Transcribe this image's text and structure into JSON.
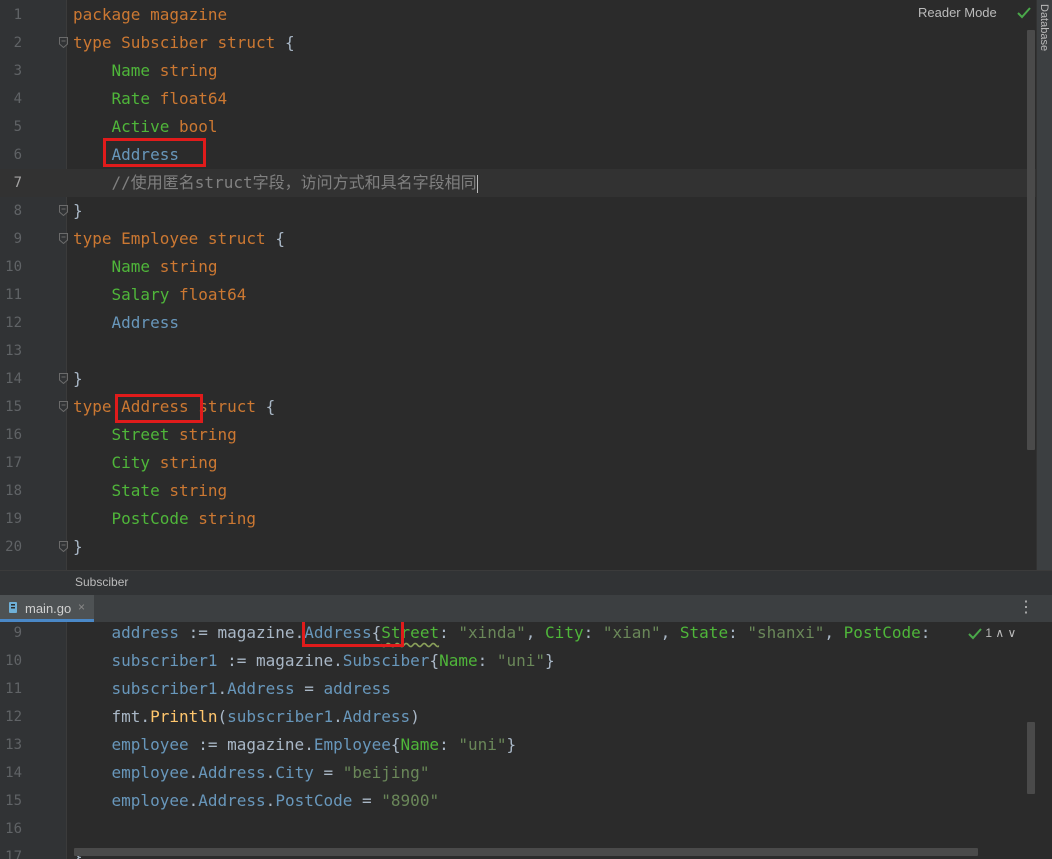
{
  "top_editor": {
    "lines": [
      {
        "n": "1",
        "tokens": [
          [
            "pkg",
            "package "
          ],
          [
            "tp",
            "magazine"
          ]
        ]
      },
      {
        "n": "2",
        "tokens": [
          [
            "kw",
            "type "
          ],
          [
            "tp",
            "Subsciber "
          ],
          [
            "kw",
            "struct "
          ],
          [
            "plain",
            "{"
          ]
        ],
        "fold": true
      },
      {
        "n": "3",
        "tokens": [
          [
            "plain",
            "    "
          ],
          [
            "fld",
            "Name "
          ],
          [
            "kw",
            "string"
          ]
        ]
      },
      {
        "n": "4",
        "tokens": [
          [
            "plain",
            "    "
          ],
          [
            "fld",
            "Rate "
          ],
          [
            "kw",
            "float64"
          ]
        ]
      },
      {
        "n": "5",
        "tokens": [
          [
            "plain",
            "    "
          ],
          [
            "fld",
            "Active "
          ],
          [
            "kw",
            "bool"
          ]
        ]
      },
      {
        "n": "6",
        "tokens": [
          [
            "plain",
            "    "
          ],
          [
            "emb",
            "Address"
          ]
        ]
      },
      {
        "n": "7",
        "tokens": [
          [
            "plain",
            "    "
          ],
          [
            "cmt",
            "//使用匿名struct字段，访问方式和具名字段相同"
          ]
        ],
        "current": true
      },
      {
        "n": "8",
        "tokens": [
          [
            "plain",
            "}"
          ]
        ],
        "fold": true
      },
      {
        "n": "9",
        "tokens": [
          [
            "kw",
            "type "
          ],
          [
            "tp",
            "Employee "
          ],
          [
            "kw",
            "struct "
          ],
          [
            "plain",
            "{"
          ]
        ],
        "fold": true
      },
      {
        "n": "10",
        "tokens": [
          [
            "plain",
            "    "
          ],
          [
            "fld",
            "Name "
          ],
          [
            "kw",
            "string"
          ]
        ]
      },
      {
        "n": "11",
        "tokens": [
          [
            "plain",
            "    "
          ],
          [
            "fld",
            "Salary "
          ],
          [
            "kw",
            "float64"
          ]
        ]
      },
      {
        "n": "12",
        "tokens": [
          [
            "plain",
            "    "
          ],
          [
            "emb",
            "Address"
          ]
        ]
      },
      {
        "n": "13",
        "tokens": []
      },
      {
        "n": "14",
        "tokens": [
          [
            "plain",
            "}"
          ]
        ],
        "fold": true
      },
      {
        "n": "15",
        "tokens": [
          [
            "kw",
            "type "
          ],
          [
            "tp",
            "Address "
          ],
          [
            "kw",
            "struct "
          ],
          [
            "plain",
            "{"
          ]
        ],
        "fold": true
      },
      {
        "n": "16",
        "tokens": [
          [
            "plain",
            "    "
          ],
          [
            "fld",
            "Street "
          ],
          [
            "kw",
            "string"
          ]
        ]
      },
      {
        "n": "17",
        "tokens": [
          [
            "plain",
            "    "
          ],
          [
            "fld",
            "City "
          ],
          [
            "kw",
            "string"
          ]
        ]
      },
      {
        "n": "18",
        "tokens": [
          [
            "plain",
            "    "
          ],
          [
            "fld",
            "State "
          ],
          [
            "kw",
            "string"
          ]
        ]
      },
      {
        "n": "19",
        "tokens": [
          [
            "plain",
            "    "
          ],
          [
            "fld",
            "PostCode "
          ],
          [
            "kw",
            "string"
          ]
        ]
      },
      {
        "n": "20",
        "tokens": [
          [
            "plain",
            "}"
          ]
        ],
        "fold": true
      }
    ]
  },
  "reader_mode_label": "Reader Mode",
  "database_label": "Database",
  "breadcrumb": "Subsciber",
  "tab": {
    "label": "main.go",
    "close": "×"
  },
  "tab_menu": "⋮",
  "inspection": "1  ∧  ∨",
  "bottom_editor": {
    "lines": [
      {
        "n": "9",
        "tokens": [
          [
            "plain",
            "    "
          ],
          [
            "var",
            "address"
          ],
          [
            "plain",
            " := magazine."
          ],
          [
            "emb",
            "Address"
          ],
          [
            "plain",
            "{"
          ],
          [
            "fld",
            "Street"
          ],
          [
            "plain",
            ": "
          ],
          [
            "str",
            "\"xinda\""
          ],
          [
            "plain",
            ", "
          ],
          [
            "fld",
            "City"
          ],
          [
            "plain",
            ": "
          ],
          [
            "str",
            "\"xian\""
          ],
          [
            "plain",
            ", "
          ],
          [
            "fld",
            "State"
          ],
          [
            "plain",
            ": "
          ],
          [
            "str",
            "\"shanxi\""
          ],
          [
            "plain",
            ", "
          ],
          [
            "fld",
            "PostCode"
          ],
          [
            "plain",
            ":"
          ]
        ]
      },
      {
        "n": "10",
        "tokens": [
          [
            "plain",
            "    "
          ],
          [
            "var",
            "subscriber1"
          ],
          [
            "plain",
            " := magazine."
          ],
          [
            "emb",
            "Subsciber"
          ],
          [
            "plain",
            "{"
          ],
          [
            "fld",
            "Name"
          ],
          [
            "plain",
            ": "
          ],
          [
            "str",
            "\"uni\""
          ],
          [
            "plain",
            "}"
          ]
        ]
      },
      {
        "n": "11",
        "tokens": [
          [
            "plain",
            "    "
          ],
          [
            "var",
            "subscriber1"
          ],
          [
            "plain",
            "."
          ],
          [
            "var",
            "Address"
          ],
          [
            "plain",
            " = "
          ],
          [
            "var",
            "address"
          ]
        ]
      },
      {
        "n": "12",
        "tokens": [
          [
            "plain",
            "    "
          ],
          [
            "plain",
            "fmt."
          ],
          [
            "call",
            "Println"
          ],
          [
            "plain",
            "("
          ],
          [
            "var",
            "subscriber1"
          ],
          [
            "plain",
            "."
          ],
          [
            "var",
            "Address"
          ],
          [
            "plain",
            ")"
          ]
        ]
      },
      {
        "n": "13",
        "tokens": [
          [
            "plain",
            "    "
          ],
          [
            "var",
            "employee"
          ],
          [
            "plain",
            " := magazine."
          ],
          [
            "emb",
            "Employee"
          ],
          [
            "plain",
            "{"
          ],
          [
            "fld",
            "Name"
          ],
          [
            "plain",
            ": "
          ],
          [
            "str",
            "\"uni\""
          ],
          [
            "plain",
            "}"
          ]
        ]
      },
      {
        "n": "14",
        "tokens": [
          [
            "plain",
            "    "
          ],
          [
            "var",
            "employee"
          ],
          [
            "plain",
            "."
          ],
          [
            "var",
            "Address"
          ],
          [
            "plain",
            "."
          ],
          [
            "var",
            "City"
          ],
          [
            "plain",
            " = "
          ],
          [
            "str",
            "\"beijing\""
          ]
        ]
      },
      {
        "n": "15",
        "tokens": [
          [
            "plain",
            "    "
          ],
          [
            "var",
            "employee"
          ],
          [
            "plain",
            "."
          ],
          [
            "var",
            "Address"
          ],
          [
            "plain",
            "."
          ],
          [
            "var",
            "PostCode"
          ],
          [
            "plain",
            " = "
          ],
          [
            "str",
            "\"8900\""
          ]
        ]
      },
      {
        "n": "16",
        "tokens": []
      },
      {
        "n": "17",
        "tokens": [
          [
            "plain",
            "}"
          ]
        ]
      }
    ]
  }
}
